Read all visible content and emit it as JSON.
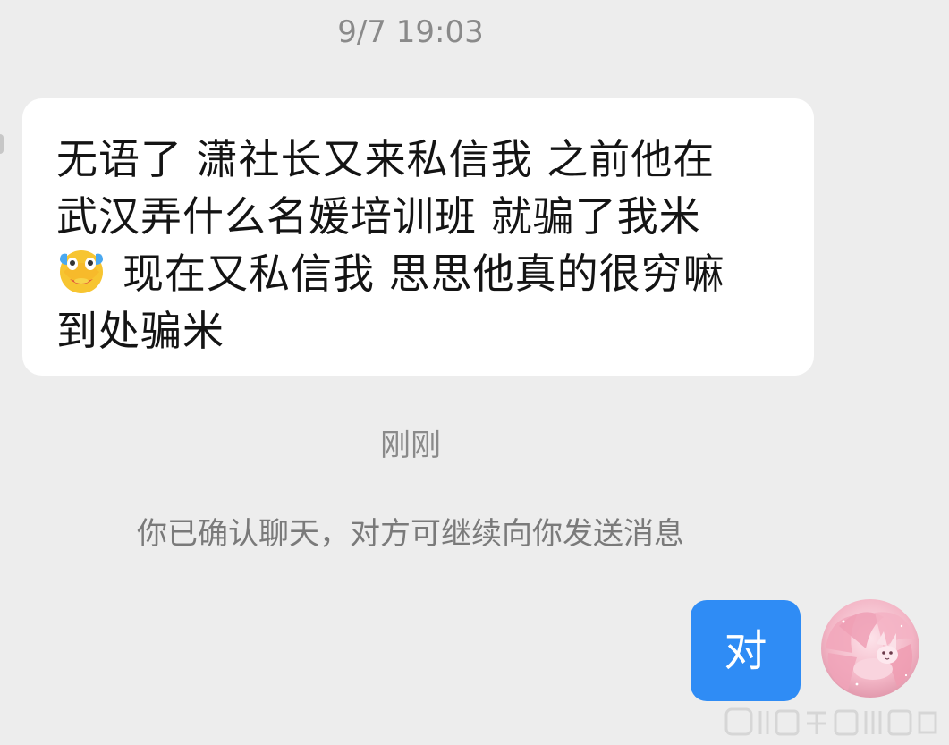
{
  "chat": {
    "timestamp_top": "9/7 19:03",
    "incoming_message": {
      "line1": "无语了 潇社长又来私信我 之前他在",
      "line2": "武汉弄什么名媛培训班 就骗了我米",
      "line3_emoji": "crying-laughing-emoji",
      "line3": "现在又私信我 思思他真的很穷嘛",
      "line4": "到处骗米"
    },
    "timestamp_recent": "刚刚",
    "system_notice": "你已确认聊天，对方可继续向你发送消息",
    "outgoing_message": "对"
  },
  "colors": {
    "background": "#ededed",
    "incoming_bubble": "#ffffff",
    "outgoing_bubble": "#2f8cf5",
    "timestamp_text": "#8a8a8a",
    "notice_text": "#7a7a7a"
  },
  "icons": {
    "avatar": "pink-fox-avatar",
    "watermark": "weibo-watermark"
  }
}
